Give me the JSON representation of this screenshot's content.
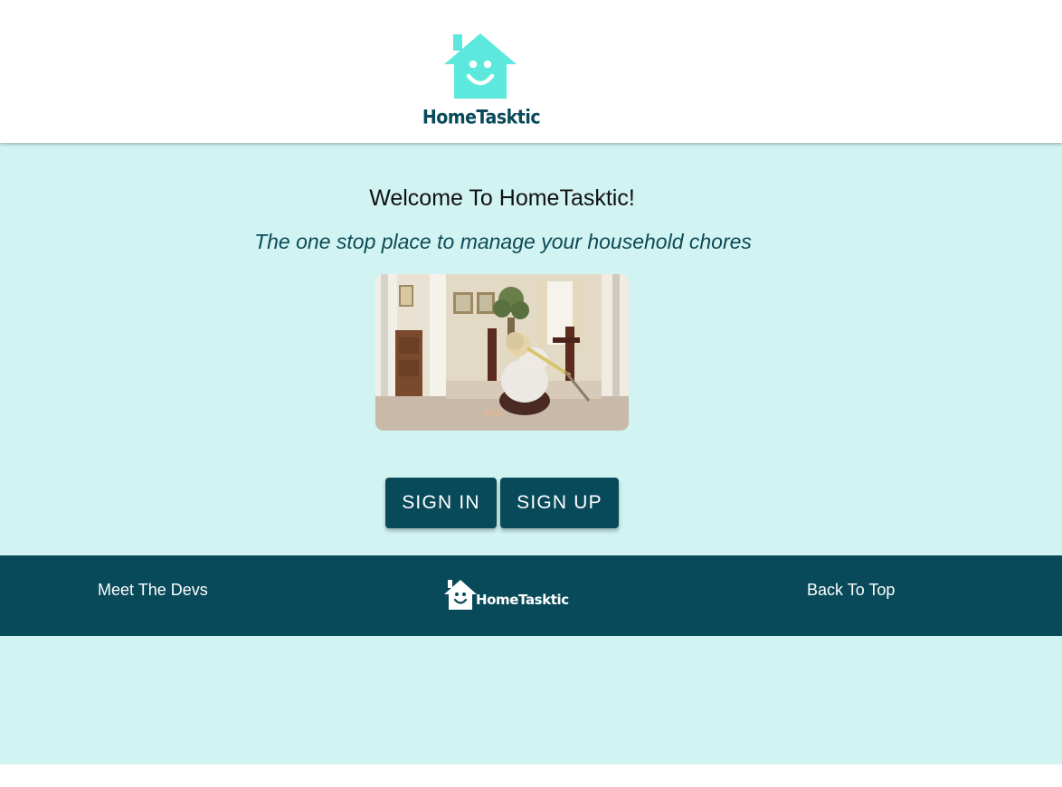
{
  "header": {
    "brand_text": "HomeTasktic"
  },
  "main": {
    "welcome": "Welcome To HomeTasktic!",
    "tagline": "The one stop place to manage your household chores",
    "sign_in_label": "SIGN IN",
    "sign_up_label": "SIGN UP"
  },
  "footer": {
    "meet_devs": "Meet The Devs",
    "brand_text": "HomeTasktic",
    "back_to_top": "Back To Top"
  },
  "colors": {
    "brand_dark": "#084a59",
    "brand_light_bg": "#d1f3f1",
    "logo_house": "#5ce8dc"
  }
}
